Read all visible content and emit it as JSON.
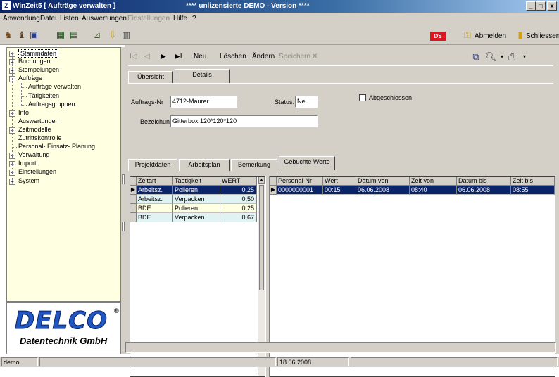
{
  "window": {
    "title": "WinZeit5 [ Aufträge verwalten ]",
    "demo_notice": "**** unlizensierte DEMO - Version ****",
    "minimize": "_",
    "maximize": "□",
    "close": "X"
  },
  "menu": {
    "items": [
      "Anwendung",
      "Datei",
      "Listen",
      "Auswertungen",
      "Einstellungen",
      "Hilfe",
      "?"
    ]
  },
  "toolbar": {
    "ds_badge": "DS",
    "abmelden": "Abmelden",
    "schliessen": "Schliessen"
  },
  "tree": {
    "items": [
      {
        "label": "Stammdaten",
        "expander": "+",
        "selected": true
      },
      {
        "label": "Buchungen",
        "expander": "+"
      },
      {
        "label": "Stempelungen",
        "expander": "+"
      },
      {
        "label": "Aufträge",
        "expander": "−"
      },
      {
        "label": "Aufträge verwalten",
        "child": true
      },
      {
        "label": "Tätigkeiten",
        "child": true
      },
      {
        "label": "Auftragsgruppen",
        "child": true
      },
      {
        "label": "Info",
        "expander": "+"
      },
      {
        "label": "Auswertungen"
      },
      {
        "label": "Zeitmodelle",
        "expander": "+"
      },
      {
        "label": "Zutrittskontrolle"
      },
      {
        "label": "Personal- Einsatz- Planung"
      },
      {
        "label": "Verwaltung",
        "expander": "+"
      },
      {
        "label": "Import",
        "expander": "+"
      },
      {
        "label": "Einstellungen",
        "expander": "+"
      },
      {
        "label": "System",
        "expander": "+"
      }
    ]
  },
  "logo": {
    "brand": "DELCO",
    "registered": "®",
    "subtitle": "Datentechnik GmbH"
  },
  "nav": {
    "first": "I◁",
    "prev": "◁",
    "next": "▶",
    "last": "▶I",
    "neu": "Neu",
    "loeschen": "Löschen",
    "aendern": "Ändern",
    "speichern": "Speichern",
    "cancel": "✕"
  },
  "main_tabs": [
    {
      "label": "Übersicht",
      "active": false
    },
    {
      "label": "Details",
      "active": true
    }
  ],
  "form": {
    "auftrags_nr_label": "Auftrags-Nr",
    "auftrags_nr_value": "4712-Maurer",
    "status_label": "Status:",
    "status_value": "Neu",
    "abgeschlossen_label": "Abgeschlossen",
    "abgeschlossen_checked": false,
    "bezeichnung_label": "Bezeichung:",
    "bezeichnung_value": "Gitterbox 120*120*120"
  },
  "sub_tabs": [
    {
      "label": "Projektdaten",
      "active": false
    },
    {
      "label": "Arbeitsplan",
      "active": false
    },
    {
      "label": "Bemerkung",
      "active": false
    },
    {
      "label": "Gebuchte Werte",
      "active": true
    }
  ],
  "left_grid": {
    "columns": [
      "Zeitart",
      "Taetigkeit",
      "WERT"
    ],
    "rows": [
      {
        "zeitart": "Arbeitsz.",
        "taetigkeit": "Polieren",
        "wert": "0,25",
        "selected": true
      },
      {
        "zeitart": "Arbeitsz.",
        "taetigkeit": "Verpacken",
        "wert": "0,50"
      },
      {
        "zeitart": "BDE",
        "taetigkeit": "Polieren",
        "wert": "0,25"
      },
      {
        "zeitart": "BDE",
        "taetigkeit": "Verpacken",
        "wert": "0,67"
      }
    ]
  },
  "right_grid": {
    "columns": [
      "Personal-Nr",
      "Wert",
      "Datum von",
      "Zeit von",
      "Datum bis",
      "Zeit bis"
    ],
    "rows": [
      {
        "personal_nr": "0000000001",
        "wert": "00:15",
        "datum_von": "06.06.2008",
        "zeit_von": "08:40",
        "datum_bis": "06.06.2008",
        "zeit_bis": "08:55",
        "selected": true
      }
    ]
  },
  "status": {
    "user": "demo",
    "date": "18.06.2008"
  },
  "colors": {
    "titlebar": "#0a246a",
    "tree_bg": "#ffffe1",
    "row_selected": "#0a246a",
    "row_alt_yellow": "#ffffe1",
    "row_alt_cyan": "#e0f2f2",
    "ds_badge": "#e0141e",
    "delco_blue": "#1f56c0"
  }
}
